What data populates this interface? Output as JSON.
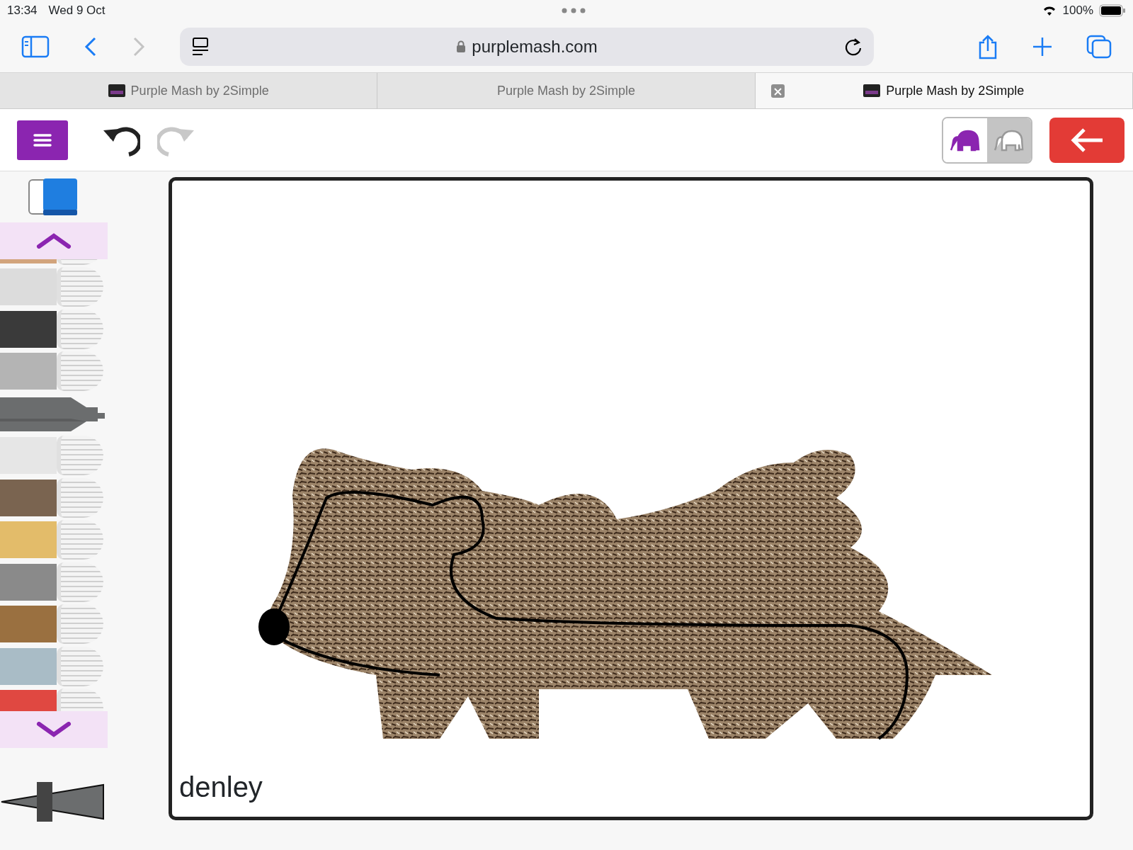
{
  "status_bar": {
    "time": "13:34",
    "date": "Wed 9 Oct",
    "battery": "100%"
  },
  "browser": {
    "url": "purplemash.com"
  },
  "tabs": [
    {
      "label": "Purple Mash by 2Simple",
      "selected": false,
      "favicon": true
    },
    {
      "label": "Purple Mash by 2Simple",
      "selected": false,
      "favicon": false
    },
    {
      "label": "Purple Mash by 2Simple",
      "selected": true,
      "favicon": true
    }
  ],
  "app_toolbar": {
    "redo_disabled": true,
    "modes": [
      {
        "selected": true
      },
      {
        "selected": false
      }
    ]
  },
  "pens": [
    {
      "kind": "pen",
      "color": "#d2a47c",
      "selected": false
    },
    {
      "kind": "pen",
      "color": "#dcdcdc",
      "selected": false
    },
    {
      "kind": "pen",
      "color": "#3a3a3a",
      "selected": false
    },
    {
      "kind": "pen",
      "color": "#b4b4b4",
      "selected": false
    },
    {
      "kind": "marker",
      "color": "#6b6d6e",
      "selected": true
    },
    {
      "kind": "pen",
      "color": "#e6e6e6",
      "selected": false
    },
    {
      "kind": "pen",
      "color": "#7a6450",
      "selected": false
    },
    {
      "kind": "pen",
      "color": "#e3bc6a",
      "selected": false
    },
    {
      "kind": "pen",
      "color": "#8a8a8a",
      "selected": false
    },
    {
      "kind": "pen",
      "color": "#9a7040",
      "selected": false
    },
    {
      "kind": "pen",
      "color": "#a9bcc6",
      "selected": false
    },
    {
      "kind": "pen",
      "color": "#e04841",
      "selected": false
    }
  ],
  "size_slider": {
    "level": 0.4
  },
  "canvas": {
    "caption": "denley"
  }
}
